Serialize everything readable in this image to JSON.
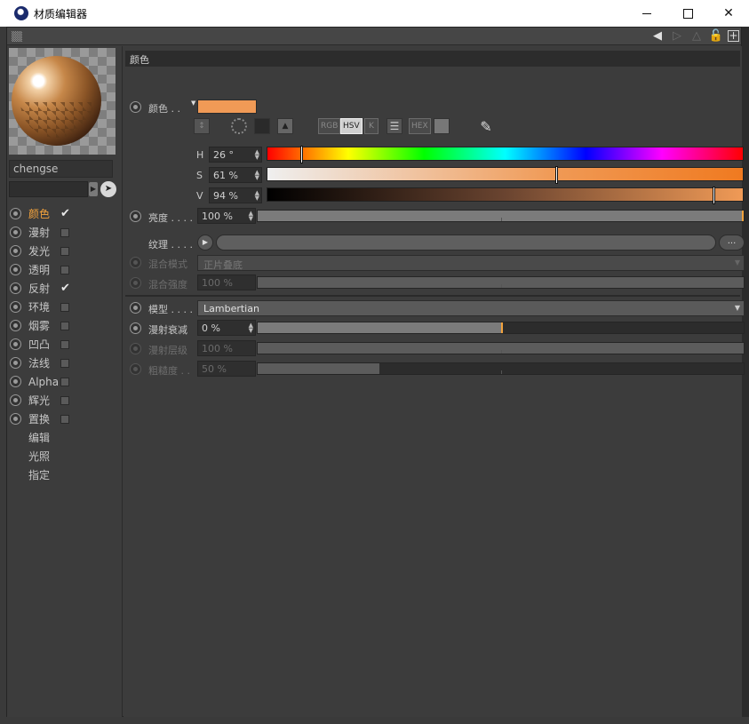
{
  "window": {
    "title": "材质编辑器",
    "buttons": [
      "minimize",
      "maximize",
      "close"
    ]
  },
  "toolbar": {
    "icons": [
      "back-arrow-icon",
      "forward-arrow-icon",
      "up-arrow-icon",
      "lock-icon",
      "new-window-icon"
    ]
  },
  "material": {
    "name": "chengse"
  },
  "channels": [
    {
      "label": "颜色",
      "checked": true,
      "active": true
    },
    {
      "label": "漫射",
      "checked": false
    },
    {
      "label": "发光",
      "checked": false
    },
    {
      "label": "透明",
      "checked": false
    },
    {
      "label": "反射",
      "checked": true
    },
    {
      "label": "环境",
      "checked": false
    },
    {
      "label": "烟雾",
      "checked": false
    },
    {
      "label": "凹凸",
      "checked": false
    },
    {
      "label": "法线",
      "checked": false
    },
    {
      "label": "Alpha",
      "checked": false
    },
    {
      "label": "辉光",
      "checked": false
    },
    {
      "label": "置换",
      "checked": false
    }
  ],
  "extra_items": [
    "编辑",
    "光照",
    "指定"
  ],
  "color_section": {
    "header": "颜色",
    "color_label": "颜色 . .",
    "swatch_color": "#f09a56",
    "modes": [
      "RGB",
      "HSV",
      "K",
      "HEX"
    ],
    "selected_mode": "HSV",
    "h": {
      "label": "H",
      "value": "26 °",
      "fraction": 0.072
    },
    "s": {
      "label": "S",
      "value": "61 %",
      "fraction": 0.61
    },
    "v": {
      "label": "V",
      "value": "94 %",
      "fraction": 0.94
    },
    "brightness": {
      "label": "亮度 . . . .",
      "value": "100 %",
      "fraction": 1.0
    },
    "texture": {
      "label": "纹理 . . . .",
      "more": "..."
    },
    "blend_mode": {
      "label": "混合模式",
      "value": "正片叠底"
    },
    "blend_strength": {
      "label": "混合强度",
      "value": "100 %",
      "fraction": 1.0
    },
    "model": {
      "label": "模型 . . . .",
      "value": "Lambertian"
    },
    "diffuse_falloff": {
      "label": "漫射衰减",
      "value": "0 %",
      "fraction": 0.5
    },
    "diffuse_level": {
      "label": "漫射层级",
      "value": "100 %",
      "fraction": 1.0
    },
    "roughness": {
      "label": "粗糙度 . .",
      "value": "50 %",
      "fraction": 0.25
    }
  },
  "colors": {
    "accent": "#f2a23c",
    "swatch": "#f09a56"
  }
}
